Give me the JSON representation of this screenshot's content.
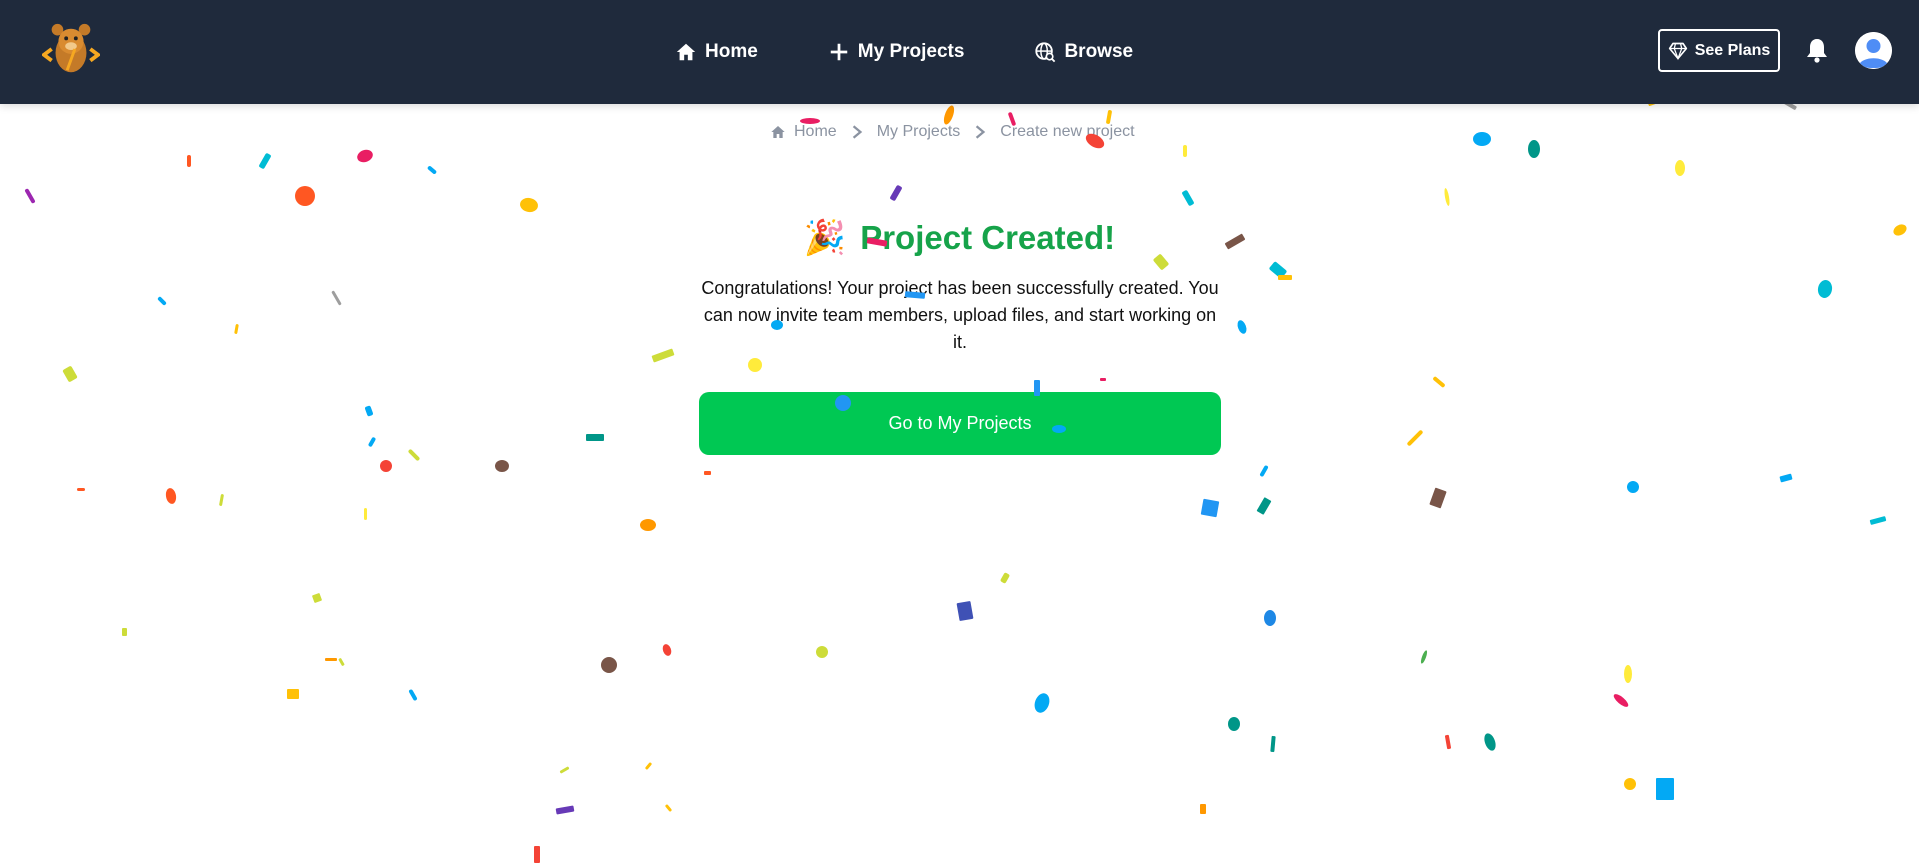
{
  "header": {
    "nav": [
      {
        "label": "Home",
        "icon": "home-icon"
      },
      {
        "label": "My Projects",
        "icon": "plus-icon"
      },
      {
        "label": "Browse",
        "icon": "globe-search-icon"
      }
    ],
    "plans_label": "See Plans"
  },
  "breadcrumb": {
    "items": [
      "Home",
      "My Projects",
      "Create new project"
    ]
  },
  "main": {
    "title": "Project Created!",
    "message": "Congratulations! Your project has been successfully created. You can now invite team members, upload files, and start working on it.",
    "cta_label": "Go to My Projects"
  },
  "colors": {
    "header_bg": "#1f2a3c",
    "title_green": "#16a34a",
    "cta_green": "#00c853",
    "breadcrumb_gray": "#8b93a1"
  }
}
